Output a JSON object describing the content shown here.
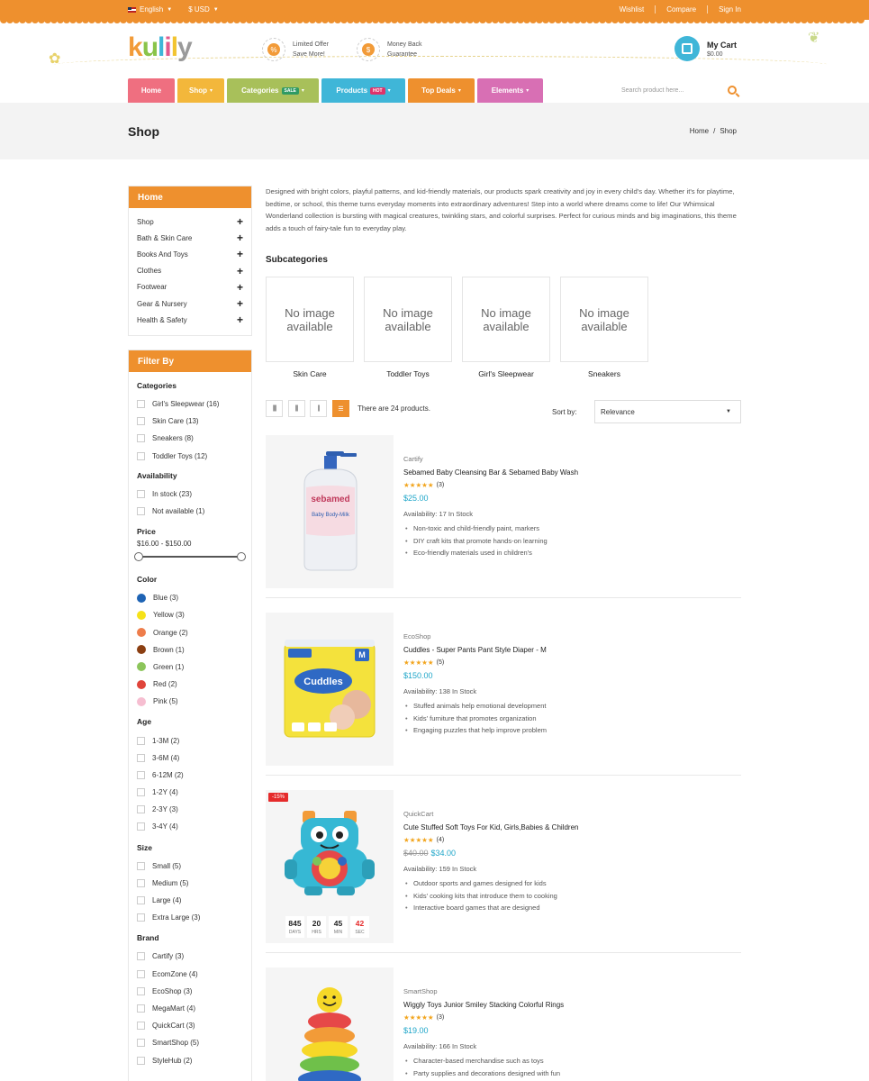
{
  "topbar": {
    "language": "English",
    "currency": "$ USD",
    "links": [
      "Wishlist",
      "Compare",
      "Sign In"
    ]
  },
  "header": {
    "logo": {
      "k": "k",
      "u": "u",
      "l": "l",
      "i": "i",
      "l2": "l",
      "y": "y"
    },
    "promo1": {
      "line1": "Limited Offer",
      "line2": "Save More!",
      "icon": "percent-icon",
      "glyph": "%"
    },
    "promo2": {
      "line1": "Money Back",
      "line2": "Guarantee",
      "icon": "money-bag-icon",
      "glyph": "$"
    },
    "cart": {
      "title": "My Cart",
      "amount": "$0.00"
    }
  },
  "nav": {
    "items": [
      {
        "label": "Home",
        "color": "#ef6f80",
        "badge": "",
        "badge_color": "",
        "caret": ""
      },
      {
        "label": "Shop",
        "color": "#f3b73b",
        "badge": "",
        "badge_color": "",
        "caret": "▾"
      },
      {
        "label": "Categories",
        "color": "#a8c05a",
        "badge": "SALE",
        "badge_color": "#2f9a64",
        "caret": "▾"
      },
      {
        "label": "Products",
        "color": "#3fb6d8",
        "badge": "HOT",
        "badge_color": "#e0326a",
        "caret": "▾"
      },
      {
        "label": "Top Deals",
        "color": "#ee902e",
        "badge": "",
        "badge_color": "",
        "caret": "▾"
      },
      {
        "label": "Elements",
        "color": "#d86fb4",
        "badge": "",
        "badge_color": "",
        "caret": "▾"
      }
    ],
    "search_placeholder": "Search product here..."
  },
  "page": {
    "title": "Shop",
    "breadcrumb": [
      "Home",
      "/",
      "Shop"
    ]
  },
  "sidebar": {
    "categories_title": "Home",
    "categories": [
      "Shop",
      "Bath & Skin Care",
      "Books And Toys",
      "Clothes",
      "Footwear",
      "Gear & Nursery",
      "Health & Safety"
    ],
    "filter_title": "Filter By",
    "groups": {
      "categories": {
        "title": "Categories",
        "items": [
          "Girl's Sleepwear (16)",
          "Skin Care (13)",
          "Sneakers (8)",
          "Toddler Toys (12)"
        ]
      },
      "availability": {
        "title": "Availability",
        "items": [
          "In stock (23)",
          "Not available (1)"
        ]
      },
      "price": {
        "title": "Price",
        "range": "$16.00 - $150.00",
        "min": 16,
        "max": 150
      },
      "color": {
        "title": "Color",
        "items": [
          {
            "label": "Blue (3)",
            "hex": "#1e63b4"
          },
          {
            "label": "Yellow (3)",
            "hex": "#f6e219"
          },
          {
            "label": "Orange (2)",
            "hex": "#ee7d4b"
          },
          {
            "label": "Brown (1)",
            "hex": "#8b3f12"
          },
          {
            "label": "Green (1)",
            "hex": "#8cc55b"
          },
          {
            "label": "Red (2)",
            "hex": "#e0443a"
          },
          {
            "label": "Pink (5)",
            "hex": "#f6bed1"
          }
        ]
      },
      "age": {
        "title": "Age",
        "items": [
          "1-3M (2)",
          "3-6M (4)",
          "6-12M (2)",
          "1-2Y (4)",
          "2-3Y (3)",
          "3-4Y (4)"
        ]
      },
      "size": {
        "title": "Size",
        "items": [
          "Small (5)",
          "Medium (5)",
          "Large (4)",
          "Extra Large (3)"
        ]
      },
      "brand": {
        "title": "Brand",
        "items": [
          "Cartify (3)",
          "EcomZone (4)",
          "EcoShop (3)",
          "MegaMart (4)",
          "QuickCart (3)",
          "SmartShop (5)",
          "StyleHub (2)"
        ]
      }
    }
  },
  "main": {
    "description": "Designed with bright colors, playful patterns, and kid-friendly materials, our products spark creativity and joy in every child's day. Whether it's for playtime, bedtime, or school, this theme turns everyday moments into extraordinary adventures! Step into a world where dreams come to life! Our Whimsical Wonderland collection is bursting with magical creatures, twinkling stars, and colorful surprises. Perfect for curious minds and big imaginations, this theme adds a touch of fairy-tale fun to everyday play.",
    "subcategories_title": "Subcategories",
    "no_image": "No image available",
    "subcategories": [
      "Skin Care",
      "Toddler Toys",
      "Girl's Sleepwear",
      "Sneakers"
    ],
    "product_count": "There are 24 products.",
    "sort_label": "Sort by:",
    "sort_value": "Relevance",
    "view_icons": [
      "||||",
      "|||",
      "||",
      "☰"
    ]
  },
  "products": [
    {
      "brand": "Cartify",
      "name": "Sebamed Baby Cleansing Bar & Sebamed Baby Wash",
      "stars": "★★★★★",
      "rating_value": 5,
      "reviews": "(3)",
      "old_price": "",
      "price": "$25.00",
      "availability": "Availability: 17 In Stock",
      "features": [
        "Non-toxic and child-friendly paint, markers",
        "DIY craft kits that promote hands-on learning",
        "Eco-friendly materials used in children's"
      ],
      "image": "baby-lotion-bottle",
      "image_text": "sebamed",
      "image_text2": "Baby Body-Milk"
    },
    {
      "brand": "EcoShop",
      "name": "Cuddles - Super Pants Pant Style Diaper - M",
      "stars": "★★★★★",
      "rating_value": 5,
      "reviews": "(5)",
      "old_price": "",
      "price": "$150.00",
      "availability": "Availability: 138 In Stock",
      "features": [
        "Stuffed animals help emotional development",
        "Kids' furniture that promotes organization",
        "Engaging puzzles that help improve problem"
      ],
      "image": "diaper-pack",
      "image_text": "Cuddles",
      "image_text2": "M"
    },
    {
      "brand": "QuickCart",
      "name": "Cute Stuffed Soft Toys For Kid, Girls,Babies & Children",
      "stars": "★★★★★",
      "rating_value": 4.5,
      "reviews": "(4)",
      "old_price": "$40.00",
      "price": "$34.00",
      "availability": "Availability: 159 In Stock",
      "features": [
        "Outdoor sports and games designed for kids",
        "Kids' cooking kits that introduce them to cooking",
        "Interactive board games that are designed"
      ],
      "image": "robot-toy",
      "sale": "-15%",
      "countdown": [
        {
          "value": "845",
          "unit": "DAYS"
        },
        {
          "value": "20",
          "unit": "HRS"
        },
        {
          "value": "45",
          "unit": "MIN"
        },
        {
          "value": "42",
          "unit": "SEC"
        }
      ]
    },
    {
      "brand": "SmartShop",
      "name": "Wiggly Toys Junior Smiley Stacking Colorful Rings",
      "stars": "★★★★★",
      "rating_value": 5,
      "reviews": "(3)",
      "old_price": "",
      "price": "$19.00",
      "availability": "Availability: 166 In Stock",
      "features": [
        "Character-based merchandise such as toys",
        "Party supplies and decorations designed with fun"
      ],
      "image": "stacking-rings"
    }
  ]
}
